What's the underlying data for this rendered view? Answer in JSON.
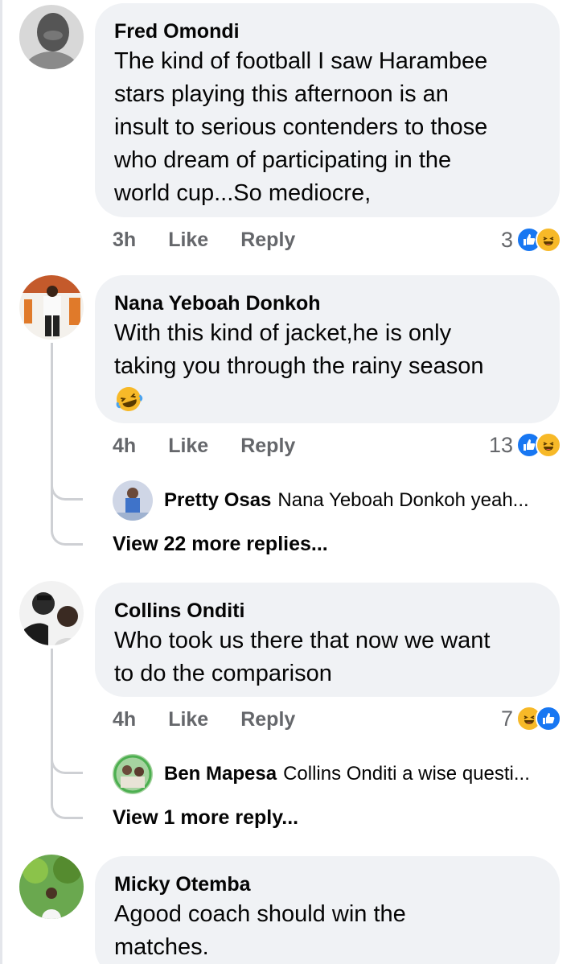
{
  "comments": [
    {
      "name": "Fred Omondi",
      "lines": [
        "The kind of football I saw Harambee",
        "stars playing this afternoon is an",
        "insult to serious contenders to those",
        "who dream of participating in the",
        "world cup...So mediocre,"
      ],
      "time": "3h",
      "like_label": "Like",
      "reply_label": "Reply",
      "reaction_count": "3",
      "reactions": [
        "like-icon",
        "haha-icon"
      ]
    },
    {
      "name": "Nana Yeboah Donkoh",
      "lines": [
        "With this kind of jacket,he is only",
        "taking you through the rainy season"
      ],
      "emoji": "laughing-crying-emoji",
      "time": "4h",
      "like_label": "Like",
      "reply_label": "Reply",
      "reaction_count": "13",
      "reactions": [
        "like-icon",
        "haha-icon"
      ],
      "reply_preview": {
        "name": "Pretty Osas",
        "text": "Nana Yeboah Donkoh  yeah..."
      },
      "view_more": "View 22 more replies..."
    },
    {
      "name": "Collins Onditi",
      "lines": [
        "Who took us there that now we want",
        "to do the comparison"
      ],
      "time": "4h",
      "like_label": "Like",
      "reply_label": "Reply",
      "reaction_count": "7",
      "reactions": [
        "haha-icon",
        "like-icon"
      ],
      "reply_preview": {
        "name": "Ben Mapesa",
        "text": "Collins Onditi a wise questi..."
      },
      "view_more": "View 1 more reply..."
    },
    {
      "name": "Micky Otemba",
      "lines": [
        "Agood coach should win the",
        "matches."
      ]
    }
  ],
  "colors": {
    "bubble": "#f0f2f5",
    "like_blue": "#1877f2",
    "haha_yellow": "#f7b928",
    "meta_gray": "#65676b",
    "thread_line": "#ced0d4"
  }
}
